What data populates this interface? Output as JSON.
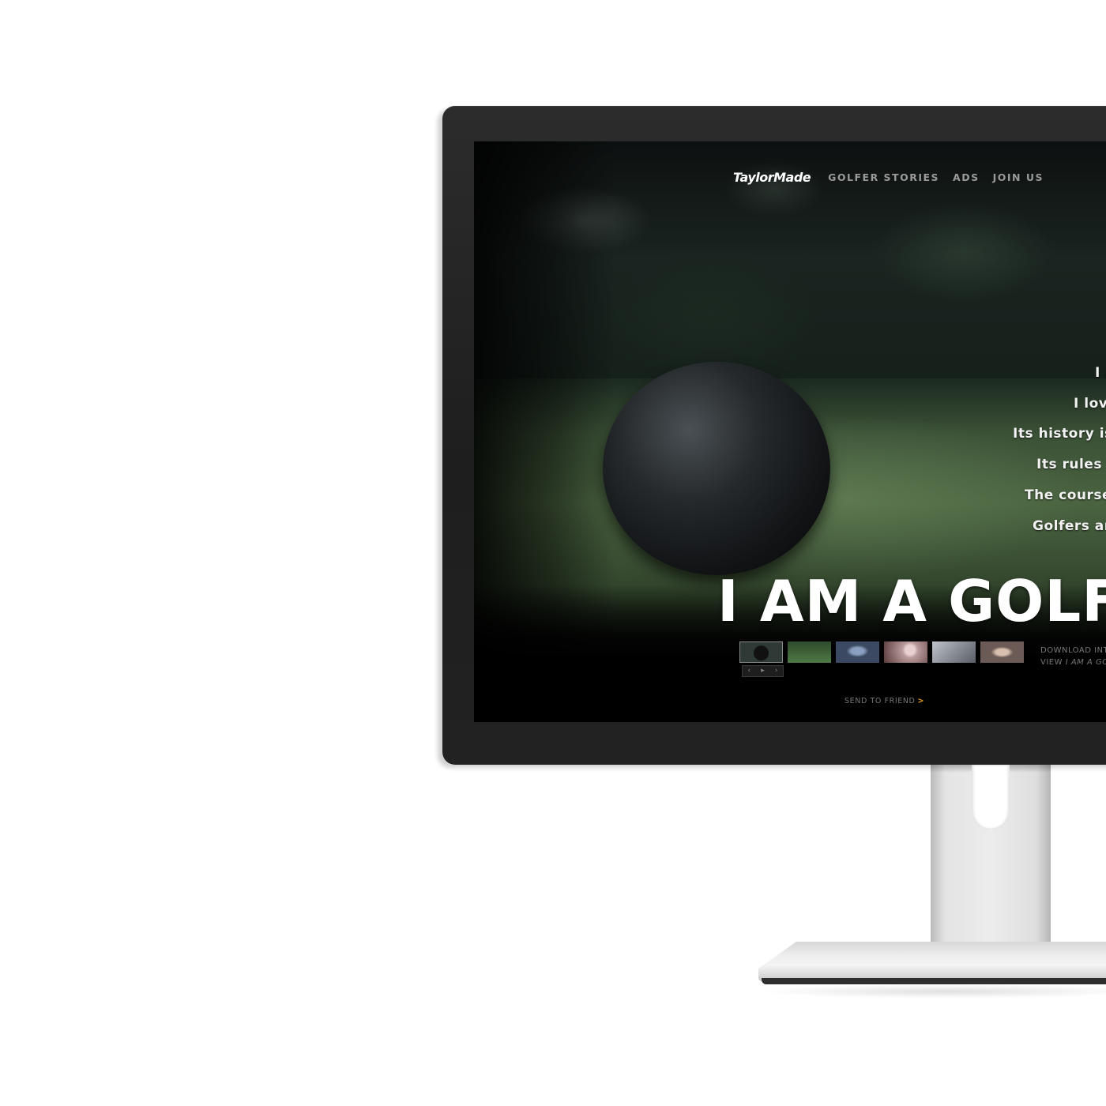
{
  "nav": {
    "logo": "TaylorMade",
    "links": [
      "GOLFER STORIES",
      "ADS",
      "JOIN US"
    ]
  },
  "poem": {
    "lines": [
      "I a",
      "I love",
      "Its history is",
      "Its rules a",
      "The course",
      "Golfers are"
    ],
    "headline": "I AM A GOLF"
  },
  "thumbnails": {
    "colors": [
      "#2f3a36",
      "#3e6b3a",
      "#3b4a62",
      "#b89a9a",
      "#8a8f98",
      "#6b5a55"
    ],
    "controls": {
      "prev": "‹",
      "play": "▸",
      "next": "›"
    }
  },
  "side_links": {
    "line1": "DOWNLOAD INT",
    "line2_prefix": "VIEW ",
    "line2_em": "I AM A GO"
  },
  "send_to_friend": {
    "label": "SEND TO FRIEND",
    "arrow": ">"
  }
}
